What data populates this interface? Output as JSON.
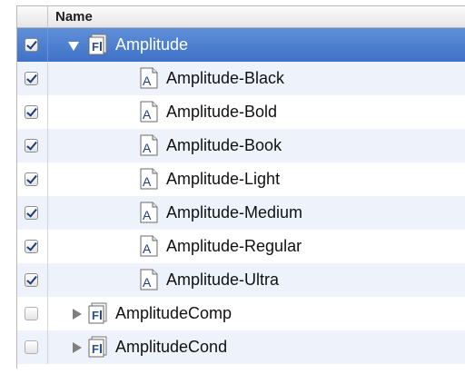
{
  "header": {
    "name": "Name"
  },
  "rows": [
    {
      "kind": "family",
      "label": "Amplitude",
      "checked": true,
      "expanded": true,
      "selected": true
    },
    {
      "kind": "font",
      "label": "Amplitude-Black",
      "checked": true
    },
    {
      "kind": "font",
      "label": "Amplitude-Bold",
      "checked": true
    },
    {
      "kind": "font",
      "label": "Amplitude-Book",
      "checked": true
    },
    {
      "kind": "font",
      "label": "Amplitude-Light",
      "checked": true
    },
    {
      "kind": "font",
      "label": "Amplitude-Medium",
      "checked": true
    },
    {
      "kind": "font",
      "label": "Amplitude-Regular",
      "checked": true
    },
    {
      "kind": "font",
      "label": "Amplitude-Ultra",
      "checked": true
    },
    {
      "kind": "family",
      "label": "AmplitudeComp",
      "checked": false,
      "expanded": false
    },
    {
      "kind": "family",
      "label": "AmplitudeCond",
      "checked": false,
      "expanded": false
    }
  ],
  "icons": {
    "family": "font-family-suitcase-icon",
    "font": "font-file-icon"
  },
  "colors": {
    "selection": "#3f72c8",
    "stripe": "#eef3fb",
    "check": "#1d3d7c"
  }
}
